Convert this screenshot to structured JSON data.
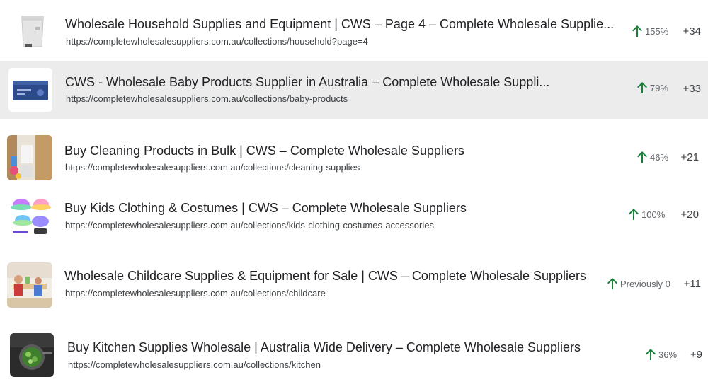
{
  "rows": [
    {
      "title": "Wholesale Household Supplies and Equipment | CWS – Page 4 – Complete Wholesale Supplie...",
      "url": "https://completewholesalesuppliers.com.au/collections/household?page=4",
      "change": "155%",
      "delta": "+34",
      "thumb_icon": "bin-product-image"
    },
    {
      "title": "CWS - Wholesale Baby Products Supplier in Australia – Complete Wholesale Suppli...",
      "url": "https://completewholesalesuppliers.com.au/collections/baby-products",
      "change": "79%",
      "delta": "+33",
      "thumb_icon": "baby-product-box-image"
    },
    {
      "title": "Buy Cleaning Products in Bulk | CWS – Complete Wholesale Suppliers",
      "url": "https://completewholesalesuppliers.com.au/collections/cleaning-supplies",
      "change": "46%",
      "delta": "+21",
      "thumb_icon": "cleaning-room-image"
    },
    {
      "title": "Buy Kids Clothing & Costumes | CWS – Complete Wholesale Suppliers",
      "url": "https://completewholesalesuppliers.com.au/collections/kids-clothing-costumes-accessories",
      "change": "100%",
      "delta": "+20",
      "thumb_icon": "kids-hats-image"
    },
    {
      "title": "Wholesale Childcare Supplies & Equipment for Sale | CWS – Complete Wholesale Suppliers",
      "url": "https://completewholesalesuppliers.com.au/collections/childcare",
      "change": "Previously 0",
      "delta": "+11",
      "thumb_icon": "childcare-room-image"
    },
    {
      "title": "Buy Kitchen Supplies Wholesale | Australia Wide Delivery – Complete Wholesale Suppliers",
      "url": "https://completewholesalesuppliers.com.au/collections/kitchen",
      "change": "36%",
      "delta": "+9",
      "thumb_icon": "kitchen-colander-image"
    }
  ],
  "colors": {
    "up_arrow": "#188038",
    "highlight_row": "#ececec"
  },
  "icons": {
    "trend": "arrow-up-icon"
  }
}
